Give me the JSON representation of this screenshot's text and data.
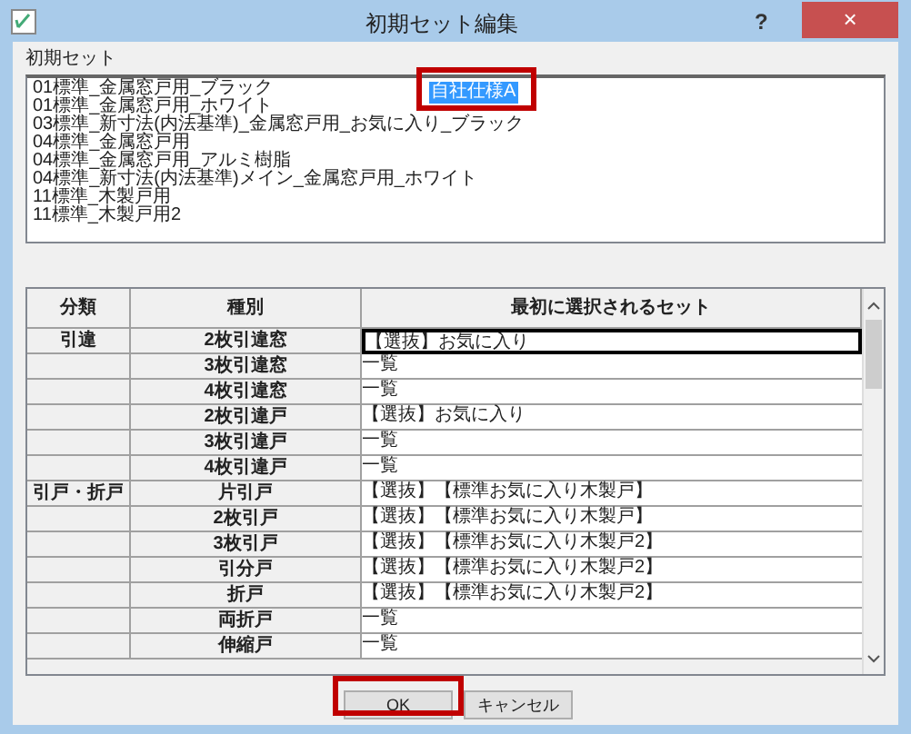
{
  "window": {
    "title": "初期セット編集",
    "help": "?",
    "close": "×"
  },
  "preset_list": {
    "label": "初期セット",
    "items": [
      {
        "text": "01標準_金属窓戸用_ブラック",
        "selected": false
      },
      {
        "text": "01標準_金属窓戸用_ホワイト",
        "selected": false
      },
      {
        "text": "03標準_新寸法(内法基準)_金属窓戸用_お気に入り_ブラック",
        "selected": false
      },
      {
        "text": "04標準_金属窓戸用",
        "selected": false
      },
      {
        "text": "04標準_金属窓戸用_アルミ樹脂",
        "selected": false
      },
      {
        "text": "04標準_新寸法(内法基準)メイン_金属窓戸用_ホワイト",
        "selected": false
      },
      {
        "text": "11標準_木製戸用",
        "selected": false
      },
      {
        "text": "11標準_木製戸用2",
        "selected": false
      }
    ],
    "edit_value": "自社仕様A"
  },
  "table": {
    "columns": [
      "分類",
      "種別",
      "最初に選択されるセット"
    ],
    "rows": [
      {
        "category": "引違",
        "type": "2枚引違窓",
        "set": "【選抜】お気に入り",
        "focused": true
      },
      {
        "type": "3枚引違窓",
        "set": "一覧",
        "focused": false
      },
      {
        "type": "4枚引違窓",
        "set": "一覧",
        "focused": false
      },
      {
        "type": "2枚引違戸",
        "set": "【選抜】お気に入り",
        "focused": false
      },
      {
        "type": "3枚引違戸",
        "set": "一覧",
        "focused": false
      },
      {
        "type": "4枚引違戸",
        "set": "一覧",
        "focused": false
      },
      {
        "category": "引戸・折戸",
        "type": "片引戸",
        "set": "【選抜】【標準お気に入り木製戸】",
        "focused": false
      },
      {
        "type": "2枚引戸",
        "set": "【選抜】【標準お気に入り木製戸】",
        "focused": false
      },
      {
        "type": "3枚引戸",
        "set": "【選抜】【標準お気に入り木製戸2】",
        "focused": false
      },
      {
        "type": "引分戸",
        "set": "【選抜】【標準お気に入り木製戸2】",
        "focused": false
      },
      {
        "type": "折戸",
        "set": "【選抜】【標準お気に入り木製戸2】",
        "focused": false
      },
      {
        "type": "両折戸",
        "set": "一覧",
        "focused": false
      },
      {
        "type": "伸縮戸",
        "set": "一覧",
        "focused": false
      }
    ]
  },
  "buttons": [
    {
      "label": "OK",
      "highlighted": true
    },
    {
      "label": "キャンセル",
      "highlighted": false
    }
  ]
}
